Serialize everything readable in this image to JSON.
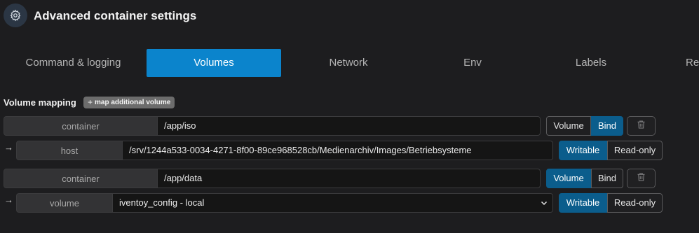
{
  "header": {
    "title": "Advanced container settings",
    "icon": "gear-icon"
  },
  "tabs": [
    {
      "label": "Command & logging"
    },
    {
      "label": "Volumes",
      "active": true
    },
    {
      "label": "Network"
    },
    {
      "label": "Env"
    },
    {
      "label": "Labels"
    },
    {
      "label": "Re"
    }
  ],
  "volume_mapping": {
    "label": "Volume mapping",
    "add_button": "map additional volume",
    "mappings": [
      {
        "container_addon": "container",
        "container_path": "/app/iso",
        "type_options": [
          "Volume",
          "Bind"
        ],
        "type_selected": "Bind",
        "source_addon": "host",
        "source_value": "/srv/1244a533-0034-4271-8f00-89ce968528cb/Medienarchiv/Images/Betriebsysteme",
        "access_options": [
          "Writable",
          "Read-only"
        ],
        "access_selected": "Writable"
      },
      {
        "container_addon": "container",
        "container_path": "/app/data",
        "type_options": [
          "Volume",
          "Bind"
        ],
        "type_selected": "Volume",
        "source_addon": "volume",
        "source_value": "iventoy_config - local",
        "access_options": [
          "Writable",
          "Read-only"
        ],
        "access_selected": "Writable"
      }
    ]
  },
  "colors": {
    "accent": "#0b84cc",
    "toggle_active": "#0b5d8c",
    "background": "#1d1d1f"
  }
}
